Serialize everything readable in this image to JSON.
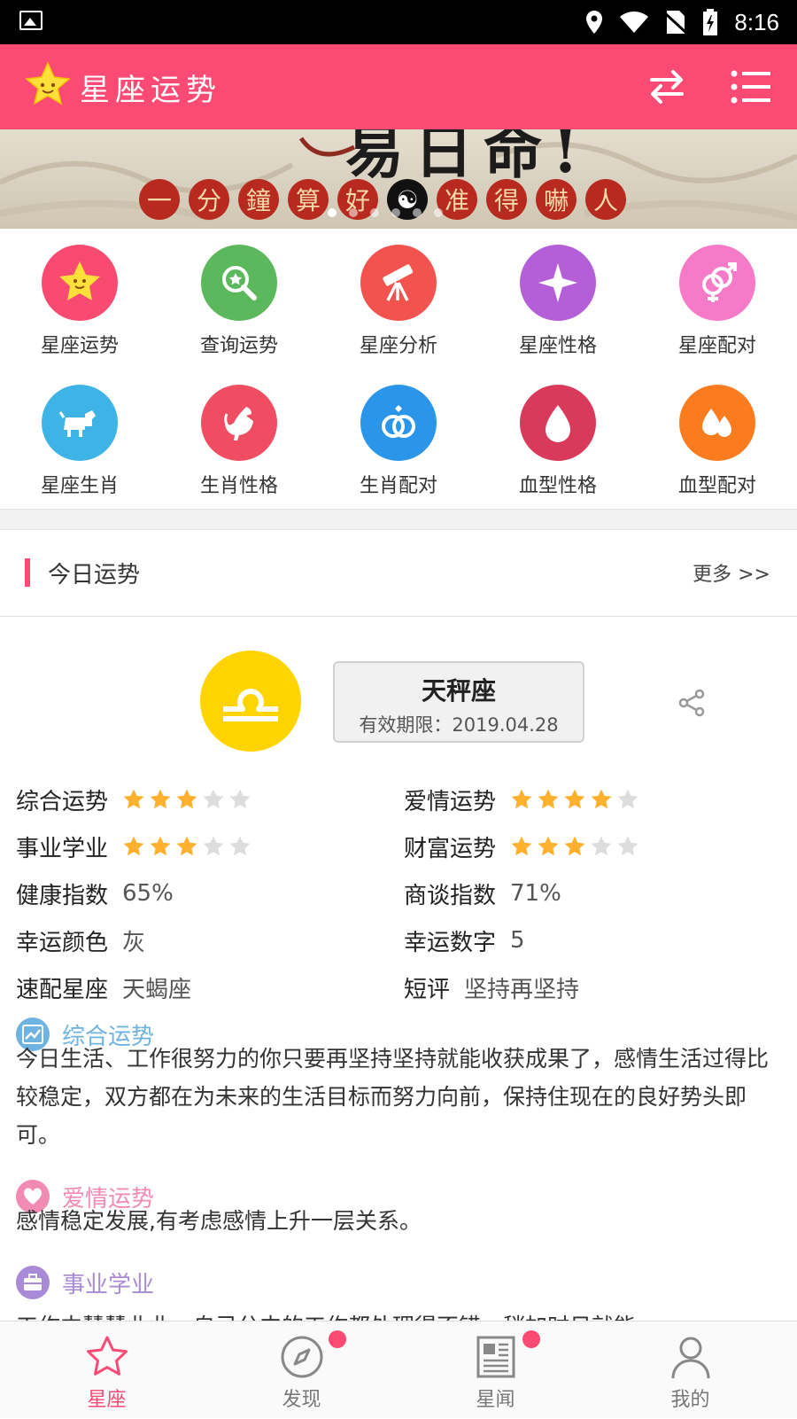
{
  "status_bar": {
    "time": "8:16"
  },
  "app_bar": {
    "title": "星座运势"
  },
  "banner": {
    "headline": "易日命!",
    "chars": [
      "一",
      "分",
      "鐘",
      "算",
      "好",
      "☯",
      "准",
      "得",
      "嚇",
      "人"
    ],
    "dot_count": 6,
    "active_dot": 0
  },
  "grid": {
    "items": [
      {
        "label": "星座运势",
        "color": "#f94b72",
        "icon": "star-face-icon"
      },
      {
        "label": "查询运势",
        "color": "#5cb85c",
        "icon": "search-star-icon"
      },
      {
        "label": "星座分析",
        "color": "#f2534f",
        "icon": "telescope-icon"
      },
      {
        "label": "星座性格",
        "color": "#b45fd8",
        "icon": "sparkle-icon"
      },
      {
        "label": "星座配对",
        "color": "#f77ac8",
        "icon": "gender-pair-icon"
      },
      {
        "label": "星座生肖",
        "color": "#3eb4e6",
        "icon": "dog-icon"
      },
      {
        "label": "生肖性格",
        "color": "#f04d62",
        "icon": "rooster-icon"
      },
      {
        "label": "生肖配对",
        "color": "#2b95e9",
        "icon": "rings-icon"
      },
      {
        "label": "血型性格",
        "color": "#d93a5b",
        "icon": "blood-drop-icon"
      },
      {
        "label": "血型配对",
        "color": "#fb7c1e",
        "icon": "double-drop-icon"
      }
    ]
  },
  "section": {
    "title": "今日运势",
    "more": "更多 >>"
  },
  "sign": {
    "name": "天秤座",
    "validity": "有效期限：2019.04.28",
    "color": "#ffd400"
  },
  "stats": {
    "overall": {
      "label": "综合运势",
      "stars": 3
    },
    "love": {
      "label": "爱情运势",
      "stars": 4
    },
    "career": {
      "label": "事业学业",
      "stars": 3
    },
    "wealth": {
      "label": "财富运势",
      "stars": 3
    },
    "health": {
      "label": "健康指数",
      "value": "65%"
    },
    "negotiation": {
      "label": "商谈指数",
      "value": "71%"
    },
    "lucky_color": {
      "label": "幸运颜色",
      "value": "灰"
    },
    "lucky_number": {
      "label": "幸运数字",
      "value": "5"
    },
    "match": {
      "label": "速配星座",
      "value": "天蝎座"
    },
    "comment": {
      "label": "短评",
      "value": "坚持再坚持"
    }
  },
  "paragraphs": {
    "overall": {
      "title": "综合运势",
      "color": "#6fb3e0",
      "text": "今日生活、工作很努力的你只要再坚持坚持就能收获成果了，感情生活过得比较稳定，双方都在为未来的生活目标而努力向前，保持住现在的良好势头即可。"
    },
    "love": {
      "title": "爱情运势",
      "color": "#f28bb4",
      "text": "感情稳定发展,有考虑感情上升一层关系。"
    },
    "career": {
      "title": "事业学业",
      "color": "#a98ad6",
      "text": "工作中慧慧业业，自己分内的工作都处理得不错，稍加时日就能"
    }
  },
  "bottom_nav": {
    "items": [
      {
        "label": "星座",
        "active": true
      },
      {
        "label": "发现",
        "badge": true
      },
      {
        "label": "星闻",
        "badge": true
      },
      {
        "label": "我的"
      }
    ]
  },
  "colors": {
    "accent": "#fb4b74",
    "star_on": "#ffb02e",
    "star_off": "#dddddd"
  }
}
